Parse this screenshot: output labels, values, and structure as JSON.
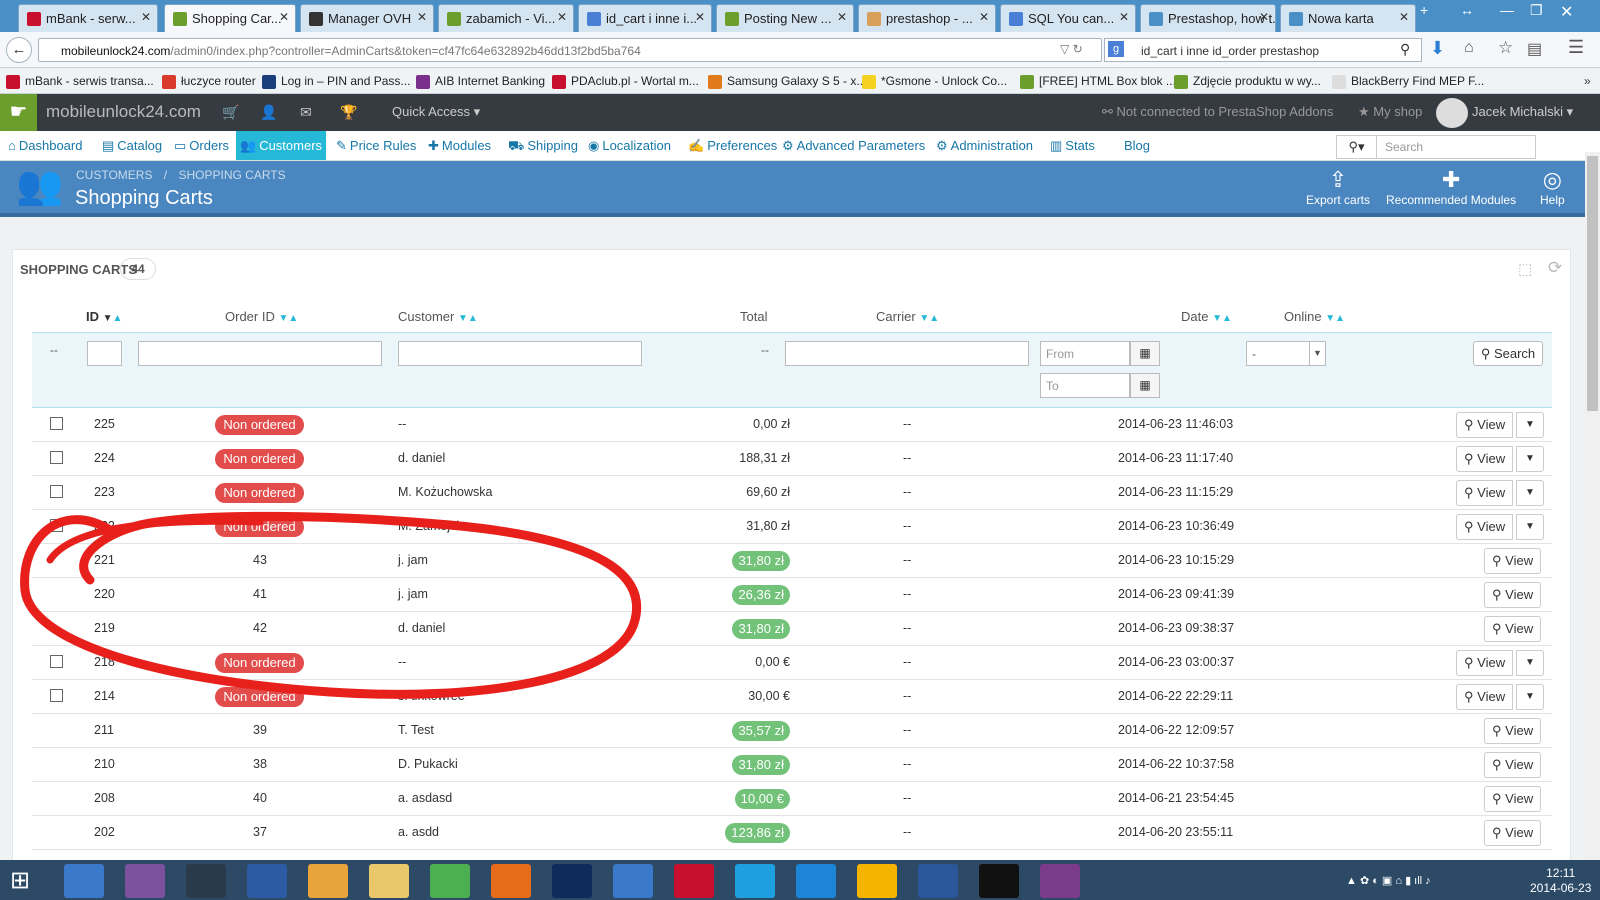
{
  "browser": {
    "tabs": [
      {
        "label": "mBank - serw...",
        "icon_color": "#c8102e"
      },
      {
        "label": "Shopping Car...",
        "icon_color": "#6c9e2e",
        "active": true
      },
      {
        "label": "Manager OVH",
        "icon_color": "#333333"
      },
      {
        "label": "zabamich - Vi...",
        "icon_color": "#6c9e2e"
      },
      {
        "label": "id_cart i inne i...",
        "icon_color": "#4a7fd6"
      },
      {
        "label": "Posting New ...",
        "icon_color": "#6c9e2e"
      },
      {
        "label": "prestashop - ...",
        "icon_color": "#d9a05b"
      },
      {
        "label": "SQL You can...",
        "icon_color": "#4a7fd6"
      },
      {
        "label": "Prestashop, how t...",
        "icon_color": "#4a90c7"
      },
      {
        "label": "Nowa karta",
        "icon_color": "#4a90c7"
      }
    ],
    "url_domain": "mobileunlock24.com",
    "url_path": "/admin0/index.php?controller=AdminCarts&token=cf47fc64e632892b46dd13f2bd5ba764",
    "search_value": "id_cart i inne id_order prestashop",
    "bookmarks": [
      {
        "label": "mBank - serwis transa...",
        "icon_color": "#c8102e"
      },
      {
        "label": "łuczyce router",
        "icon_color": "#d93a2b"
      },
      {
        "label": "Log in – PIN and Pass...",
        "icon_color": "#1a3d7c"
      },
      {
        "label": "AIB Internet Banking",
        "icon_color": "#7b2f8c"
      },
      {
        "label": "PDAclub.pl - Wortal m...",
        "icon_color": "#c8102e"
      },
      {
        "label": "Samsung Galaxy S 5 - x...",
        "icon_color": "#e07a1b"
      },
      {
        "label": "*Gsmone - Unlock Co...",
        "icon_color": "#f4d21f"
      },
      {
        "label": "[FREE] HTML Box blok ...",
        "icon_color": "#6c9e2e"
      },
      {
        "label": "Zdjęcie produktu w wy...",
        "icon_color": "#6c9e2e"
      },
      {
        "label": "BlackBerry Find MEP F...",
        "icon_color": "#dddddd"
      }
    ]
  },
  "header": {
    "shop_name": "mobileunlock24.com",
    "quick_access": "Quick Access",
    "addons_status": "Not connected to PrestaShop Addons",
    "my_shop": "My shop",
    "user": "Jacek Michalski"
  },
  "menu": [
    {
      "label": "Dashboard",
      "icon": "⌂"
    },
    {
      "label": "Catalog",
      "icon": "▤"
    },
    {
      "label": "Orders",
      "icon": "▭"
    },
    {
      "label": "Customers",
      "icon": "👥",
      "active": true
    },
    {
      "label": "Price Rules",
      "icon": "✎"
    },
    {
      "label": "Modules",
      "icon": "✚"
    },
    {
      "label": "Shipping",
      "icon": "⛟"
    },
    {
      "label": "Localization",
      "icon": "◉"
    },
    {
      "label": "Preferences",
      "icon": "✍"
    },
    {
      "label": "Advanced Parameters",
      "icon": "⚙"
    },
    {
      "label": "Administration",
      "icon": "⚙"
    },
    {
      "label": "Stats",
      "icon": "▥"
    },
    {
      "label": "Blog",
      "icon": ""
    }
  ],
  "admin_search_placeholder": "Search",
  "breadcrumb": {
    "first": "CUSTOMERS",
    "second": "SHOPPING CARTS"
  },
  "page_title": "Shopping Carts",
  "toolbar": {
    "export": "Export carts",
    "recommended": "Recommended Modules",
    "help": "Help"
  },
  "panel": {
    "title": "SHOPPING CARTS",
    "count": "44"
  },
  "columns": {
    "id": "ID",
    "order_id": "Order ID",
    "customer": "Customer",
    "total": "Total",
    "carrier": "Carrier",
    "date": "Date",
    "online": "Online"
  },
  "filters": {
    "dash": "--",
    "total_dash": "--",
    "from": "From",
    "to": "To",
    "online_value": "-",
    "search_button": "Search"
  },
  "rows": [
    {
      "id": "225",
      "order": "Non ordered",
      "customer": "--",
      "total": "0,00 zł",
      "carrier": "--",
      "date": "2014-06-23 11:46:03",
      "ordered": false
    },
    {
      "id": "224",
      "order": "Non ordered",
      "customer": "d. daniel",
      "total": "188,31 zł",
      "carrier": "--",
      "date": "2014-06-23 11:17:40",
      "ordered": false
    },
    {
      "id": "223",
      "order": "Non ordered",
      "customer": "M. Kożuchowska",
      "total": "69,60 zł",
      "carrier": "--",
      "date": "2014-06-23 11:15:29",
      "ordered": false
    },
    {
      "id": "222",
      "order": "Non ordered",
      "customer": "M. Zamojcin",
      "total": "31,80 zł",
      "carrier": "--",
      "date": "2014-06-23 10:36:49",
      "ordered": false
    },
    {
      "id": "221",
      "order": "43",
      "customer": "j. jam",
      "total": "31,80 zł",
      "carrier": "--",
      "date": "2014-06-23 10:15:29",
      "ordered": true
    },
    {
      "id": "220",
      "order": "41",
      "customer": "j. jam",
      "total": "26,36 zł",
      "carrier": "--",
      "date": "2014-06-23 09:41:39",
      "ordered": true
    },
    {
      "id": "219",
      "order": "42",
      "customer": "d. daniel",
      "total": "31,80 zł",
      "carrier": "--",
      "date": "2014-06-23 09:38:37",
      "ordered": true
    },
    {
      "id": "218",
      "order": "Non ordered",
      "customer": "--",
      "total": "0,00 €",
      "carrier": "--",
      "date": "2014-06-23 03:00:37",
      "ordered": false
    },
    {
      "id": "214",
      "order": "Non ordered",
      "customer": "s. tinkowree",
      "total": "30,00 €",
      "carrier": "--",
      "date": "2014-06-22 22:29:11",
      "ordered": false
    },
    {
      "id": "211",
      "order": "39",
      "customer": "T. Test",
      "total": "35,57 zł",
      "carrier": "--",
      "date": "2014-06-22 12:09:57",
      "ordered": true
    },
    {
      "id": "210",
      "order": "38",
      "customer": "D. Pukacki",
      "total": "31,80 zł",
      "carrier": "--",
      "date": "2014-06-22 10:37:58",
      "ordered": true
    },
    {
      "id": "208",
      "order": "40",
      "customer": "a. asdasd",
      "total": "10,00 €",
      "carrier": "--",
      "date": "2014-06-21 23:54:45",
      "ordered": true
    },
    {
      "id": "202",
      "order": "37",
      "customer": "a. asdd",
      "total": "123,86 zł",
      "carrier": "--",
      "date": "2014-06-20 23:55:11",
      "ordered": true
    }
  ],
  "view_label": "View",
  "taskbar": {
    "apps": [
      "#3a78c9",
      "#7b519d",
      "#2a3a4a",
      "#2d5ba3",
      "#e8a33a",
      "#e9c86b",
      "#4caf50",
      "#e66b1a",
      "#0f2a5c",
      "#3a78c9",
      "#c8102e",
      "#1ea0e0",
      "#1c85d8",
      "#f4b400",
      "#2b579a",
      "#111111",
      "#7a3b8c"
    ],
    "time": "12:11",
    "date": "2014-06-23"
  },
  "colors": {
    "accent": "#25b9d7",
    "header_blue": "#4a86c0",
    "non_ordered": "#e24c4b",
    "ordered": "#72c279",
    "annotation": "#e8201c"
  }
}
